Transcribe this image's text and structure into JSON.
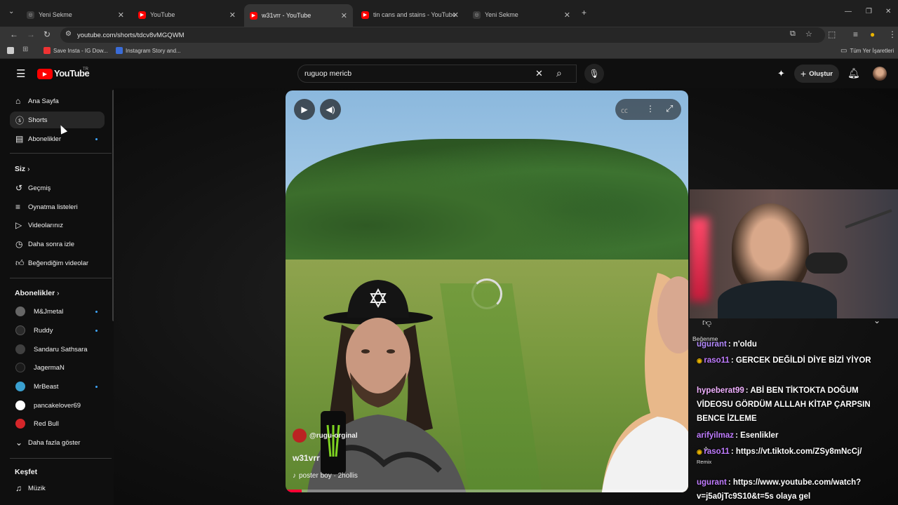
{
  "tabs": [
    {
      "title": "Yeni Sekme",
      "active": false
    },
    {
      "title": "YouTube",
      "active": false
    },
    {
      "title": "w31vrr - YouTube",
      "active": true
    },
    {
      "title": "tin cans and stains - YouTube",
      "active": false
    },
    {
      "title": "Yeni Sekme",
      "active": false
    }
  ],
  "url": "youtube.com/shorts/tdcv8vMGQWM",
  "bookmarks": [
    "Save Insta - IG Dow...",
    "Instagram Story and...",
    "Tüm Yer İşaretleri"
  ],
  "header": {
    "logo": "YouTube",
    "logo_region": "TR",
    "search_value": "ruguop mericb",
    "create_label": "Oluştur"
  },
  "sidebar": {
    "main": [
      {
        "label": "Ana Sayfa",
        "icon": "home-icon"
      },
      {
        "label": "Shorts",
        "icon": "shorts-icon"
      },
      {
        "label": "Abonelikler",
        "icon": "subscriptions-icon"
      }
    ],
    "you_title": "Siz",
    "you": [
      {
        "label": "Geçmiş",
        "icon": "history-icon"
      },
      {
        "label": "Oynatma listeleri",
        "icon": "playlist-icon"
      },
      {
        "label": "Videolarınız",
        "icon": "your-videos-icon"
      },
      {
        "label": "Daha sonra izle",
        "icon": "clock-icon"
      },
      {
        "label": "Beğendiğim videolar",
        "icon": "thumbs-up-icon"
      }
    ],
    "subs_title": "Abonelikler",
    "subs": [
      {
        "label": "M&Jmetal",
        "color": "#666666",
        "dot": true
      },
      {
        "label": "Ruddy",
        "color": "#2a2a2a",
        "dot": true
      },
      {
        "label": "Sandaru Sathsara",
        "color": "#404040",
        "dot": false
      },
      {
        "label": "JagermaN",
        "color": "#1a1a1a",
        "dot": false
      },
      {
        "label": "MrBeast",
        "color": "#3aa0d0",
        "dot": true
      },
      {
        "label": "pancakelover69",
        "color": "#ffffff",
        "dot": false
      },
      {
        "label": "Red Bull",
        "color": "#d4262a",
        "dot": false
      }
    ],
    "show_more": "Daha fazla göster",
    "explore_title": "Keşfet",
    "explore": [
      {
        "label": "Müzik",
        "icon": "music-icon"
      }
    ]
  },
  "video": {
    "channel": "@rugu-orginal",
    "title": "w31vrr",
    "sound": "poster boy · 2hollis"
  },
  "chat": {
    "like_label": "Beğenme",
    "remix_label": "Remix",
    "messages": [
      {
        "user": "ugurant",
        "user_color": "#b48aff",
        "text": ": n'oldu"
      },
      {
        "user": "raso11",
        "user_color": "#c07cff",
        "text": ": GERCEK DEĞİLDİ DİYE BİZİ YİYOR"
      },
      {
        "user": "hypeberat99",
        "user_color": "#f0b0ff",
        "text": ": ABİ BEN TİKTOKTA DOĞUM VİDEOSU GÖRDÜM ALLLAH KİTAP ÇARPSIN BENCE İZLEME"
      },
      {
        "user": "arifyilmaz",
        "user_color": "#c07cff",
        "text": ": Esenlikler"
      },
      {
        "user": "raso11",
        "user_color": "#c07cff",
        "text": ": https://vt.tiktok.com/ZSy8mNcCj/"
      },
      {
        "user": "ugurant",
        "user_color": "#c07cff",
        "text": ": https://www.youtube.com/watch?v=j5a0jTc9S10&t=5s olaya gel"
      }
    ]
  }
}
